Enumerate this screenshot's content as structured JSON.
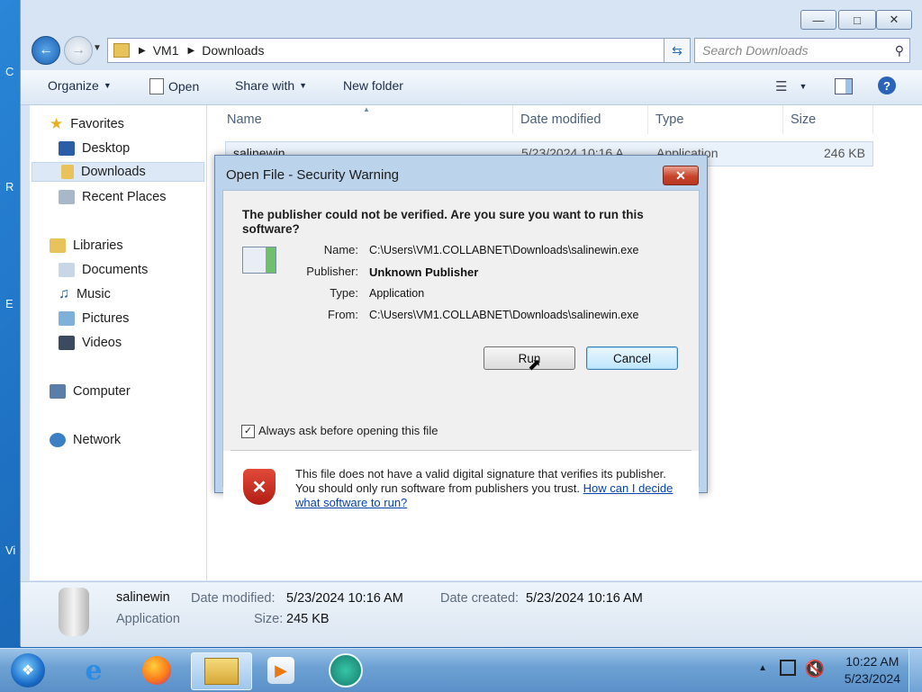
{
  "explorer": {
    "breadcrumb": [
      "VM1",
      "Downloads"
    ],
    "search_placeholder": "Search Downloads",
    "toolbar": {
      "organize": "Organize",
      "open": "Open",
      "share_with": "Share with",
      "new_folder": "New folder"
    },
    "nav": {
      "favorites": "Favorites",
      "desktop": "Desktop",
      "downloads": "Downloads",
      "recent_places": "Recent Places",
      "libraries": "Libraries",
      "documents": "Documents",
      "music": "Music",
      "pictures": "Pictures",
      "videos": "Videos",
      "computer": "Computer",
      "network": "Network"
    },
    "columns": {
      "name": "Name",
      "date_modified": "Date modified",
      "type": "Type",
      "size": "Size"
    },
    "file": {
      "name": "salinewin",
      "date": "5/23/2024 10:16 A",
      "type": "Application",
      "size": "246 KB"
    },
    "details": {
      "name": "salinewin",
      "type": "Application",
      "date_modified_label": "Date modified:",
      "date_modified": "5/23/2024 10:16 AM",
      "date_created_label": "Date created:",
      "date_created": "5/23/2024 10:16 AM",
      "size_label": "Size:",
      "size": "245 KB"
    }
  },
  "dialog": {
    "title": "Open File - Security Warning",
    "heading": "The publisher could not be verified.  Are you sure you want to run this software?",
    "name_label": "Name:",
    "name_value": "C:\\Users\\VM1.COLLABNET\\Downloads\\salinewin.exe",
    "publisher_label": "Publisher:",
    "publisher_value": "Unknown Publisher",
    "type_label": "Type:",
    "type_value": "Application",
    "from_label": "From:",
    "from_value": "C:\\Users\\VM1.COLLABNET\\Downloads\\salinewin.exe",
    "run": "Run",
    "cancel": "Cancel",
    "checkbox_label": "Always ask before opening this file",
    "checkbox_checked": true,
    "warning_text": "This file does not have a valid digital signature that verifies its publisher. You should only run software from publishers you trust.",
    "help_link": "How can I decide what software to run?"
  },
  "taskbar": {
    "clock_time": "10:22 AM",
    "clock_date": "5/23/2024"
  }
}
